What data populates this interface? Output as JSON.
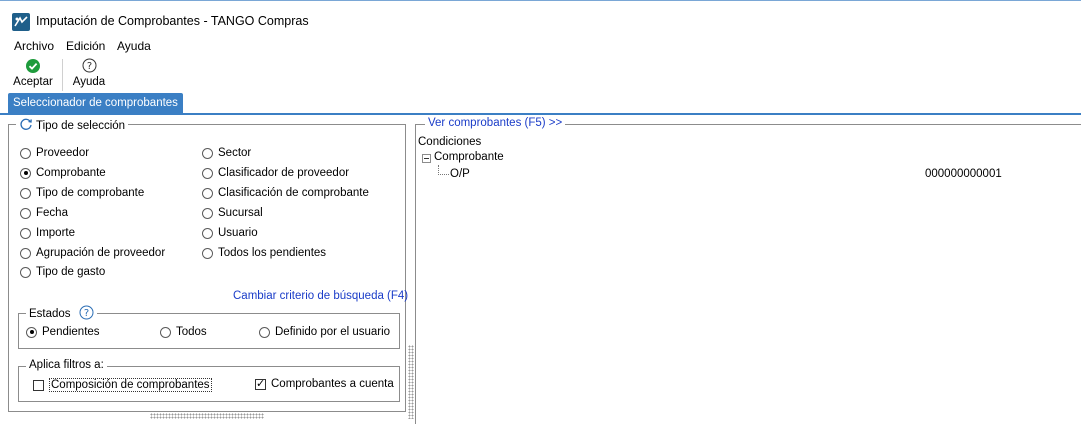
{
  "window": {
    "title": "Imputación de Comprobantes - TANGO Compras"
  },
  "menu": [
    {
      "label": "Archivo"
    },
    {
      "label": "Edición"
    },
    {
      "label": "Ayuda"
    }
  ],
  "toolbar": {
    "accept_label": "Aceptar",
    "help_label": "Ayuda"
  },
  "tabs": [
    {
      "label": "Seleccionador de comprobantes",
      "active": true
    }
  ],
  "selection": {
    "legend": "Tipo de selección",
    "options_left": [
      "Proveedor",
      "Comprobante",
      "Tipo de comprobante",
      "Fecha",
      "Importe",
      "Agrupación de proveedor",
      "Tipo de gasto"
    ],
    "options_right": [
      "Sector",
      "Clasificador de proveedor",
      "Clasificación de comprobante",
      "Sucursal",
      "Usuario",
      "Todos los pendientes"
    ],
    "selected": "Comprobante",
    "change_criteria_link": "Cambiar criterio de búsqueda (F4)"
  },
  "estados": {
    "legend": "Estados",
    "options": [
      "Pendientes",
      "Todos",
      "Definido por el usuario"
    ],
    "selected": "Pendientes"
  },
  "filtros": {
    "legend": "Aplica filtros a:",
    "composicion_label": "Composición de comprobantes",
    "composicion_checked": false,
    "cuenta_label": "Comprobantes a cuenta",
    "cuenta_checked": true
  },
  "right_panel": {
    "legend": "Ver comprobantes (F5) >>",
    "root_label": "Condiciones",
    "node_label": "Comprobante",
    "leaf_label": "O/P",
    "leaf_value": "000000000001"
  },
  "colors": {
    "accent": "#3b7fc4",
    "link": "#1a3cc8",
    "ok_green": "#1e9b3c"
  }
}
